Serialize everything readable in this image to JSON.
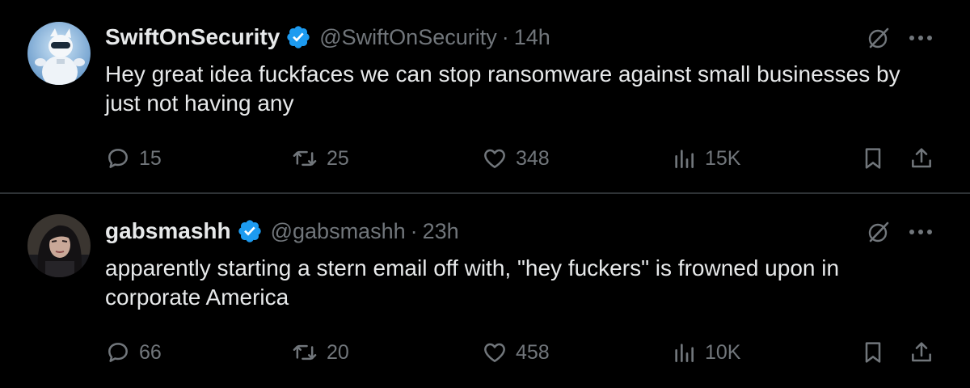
{
  "tweets": [
    {
      "display_name": "SwiftOnSecurity",
      "handle": "@SwiftOnSecurity",
      "separator": "·",
      "time": "14h",
      "text": "Hey great idea fuckfaces we can stop ransomware against small businesses by just not having any",
      "replies": "15",
      "retweets": "25",
      "likes": "348",
      "views": "15K"
    },
    {
      "display_name": "gabsmashh",
      "handle": "@gabsmashh",
      "separator": "·",
      "time": "23h",
      "text": "apparently starting a stern email off with, \"hey fuckers\" is frowned upon in corporate America",
      "replies": "66",
      "retweets": "20",
      "likes": "458",
      "views": "10K"
    }
  ],
  "colors": {
    "background": "#000000",
    "text_primary": "#e7e9ea",
    "text_secondary": "#71767b",
    "verified_badge": "#1d9bf0",
    "divider": "#2f3336"
  },
  "icons": {
    "verified": "verified-badge-icon",
    "grok": "grok-slash-icon",
    "more": "more-dots-icon",
    "reply": "reply-bubble-icon",
    "retweet": "retweet-arrows-icon",
    "like": "heart-icon",
    "views": "analytics-bars-icon",
    "bookmark": "bookmark-icon",
    "share": "share-upload-icon"
  }
}
